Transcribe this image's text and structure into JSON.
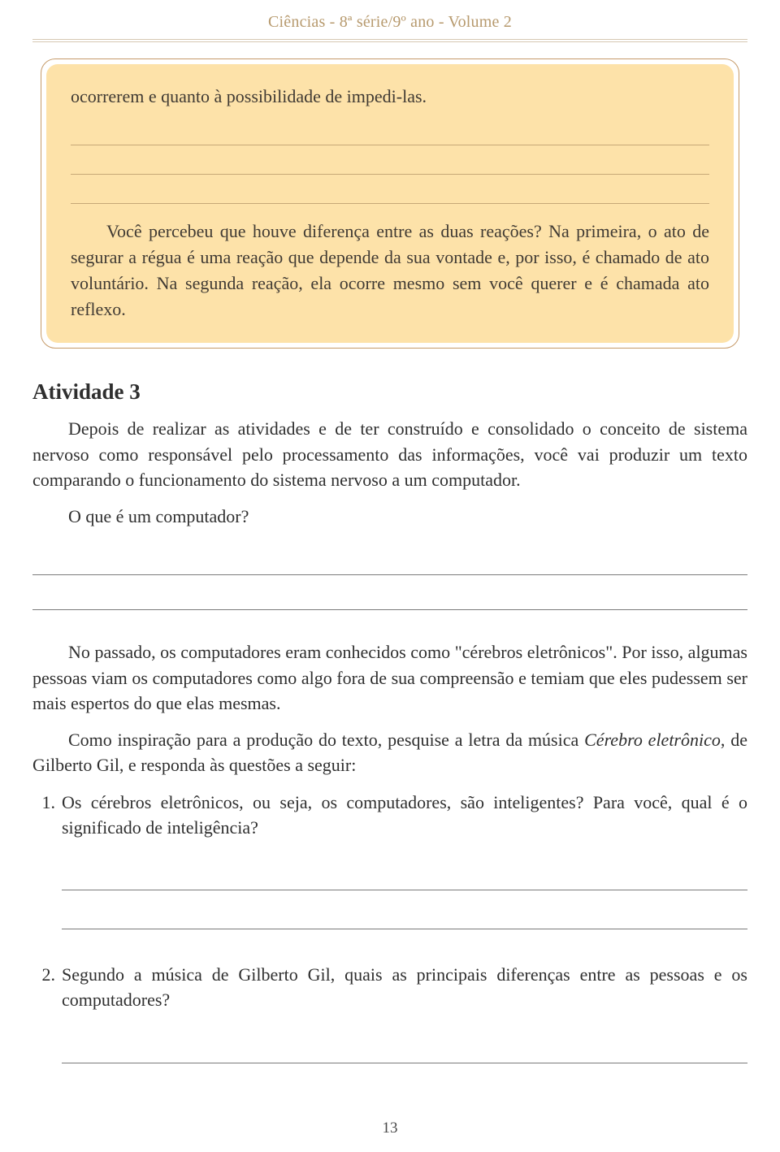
{
  "header": {
    "title": "Ciências - 8ª série/9º ano - Volume 2"
  },
  "box": {
    "p1": "ocorrerem e quanto à possibilidade de impedi-las.",
    "p2": "Você percebeu que houve diferença entre as duas reações? Na primeira, o ato de segurar a régua é uma reação que depende da sua vontade e, por isso, é chamado de ato voluntário. Na segunda reação, ela ocorre mesmo sem você querer e é chamada ato reflexo."
  },
  "activity": {
    "title": "Atividade 3",
    "p1": "Depois de realizar as atividades e de ter construído e consolidado o conceito de sistema nervoso como responsável pelo processamento das informações, você vai produzir um texto comparando o funcionamento do sistema nervoso a um computador.",
    "p2": "O que é um computador?",
    "p3": "No passado, os computadores eram conhecidos como \"cérebros eletrônicos\". Por isso, algumas pessoas viam os computadores como algo fora de sua compreensão e temiam que eles pudessem ser mais espertos do que elas mesmas.",
    "p4a": "Como inspiração para a produção do texto, pesquise a letra da música ",
    "p4music": "Cérebro eletrônico",
    "p4b": ", de Gilberto Gil, e responda às questões a seguir:"
  },
  "questions": {
    "q1": {
      "num": "1.",
      "text": "Os cérebros eletrônicos, ou seja, os computadores, são inteligentes? Para você, qual é o significado de inteligência?"
    },
    "q2": {
      "num": "2.",
      "text": "Segundo a música de Gilberto Gil, quais as principais diferenças entre as pessoas e os computadores?"
    }
  },
  "page_number": "13"
}
